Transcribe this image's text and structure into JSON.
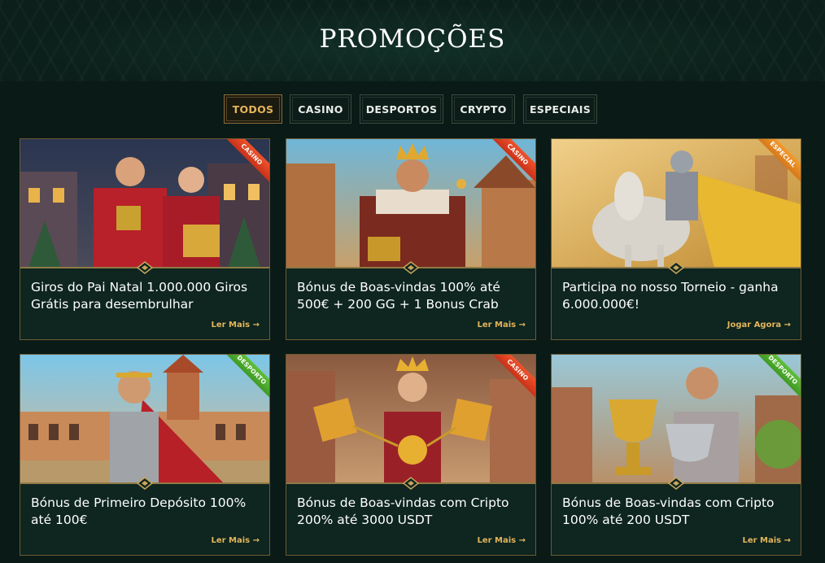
{
  "page": {
    "title": "PROMOÇÕES"
  },
  "filters": [
    {
      "label": "TODOS",
      "active": true
    },
    {
      "label": "CASINO",
      "active": false
    },
    {
      "label": "DESPORTOS",
      "active": false
    },
    {
      "label": "CRYPTO",
      "active": false
    },
    {
      "label": "ESPECIAIS",
      "active": false
    }
  ],
  "promotions": [
    {
      "badge": "CASINO",
      "badge_type": "casino",
      "title": "Giros do Pai Natal 1.000.000 Giros Grátis para desembrulhar",
      "link": "Ler Mais →",
      "image": "santa-couple-christmas"
    },
    {
      "badge": "CASINO",
      "badge_type": "casino",
      "title": "Bónus de Boas-vindas 100% até 500€ + 200 GG + 1 Bonus Crab",
      "link": "Ler Mais →",
      "image": "king-with-treasure"
    },
    {
      "badge": "ESPECIAL",
      "badge_type": "especial",
      "title": "Participa no nosso Torneio - ganha 6.000.000€!",
      "link": "Jogar Agora →",
      "image": "knight-on-horse"
    },
    {
      "badge": "DESPORTO",
      "badge_type": "desporto",
      "title": "Bónus de Primeiro Depósito 100% até 100€",
      "link": "Ler Mais →",
      "image": "gladiator-arena"
    },
    {
      "badge": "CASINO",
      "badge_type": "casino",
      "title": "Bónus de Boas-vindas com Cripto 200% até 3000 USDT",
      "link": "Ler Mais →",
      "image": "queen-crypto-coins"
    },
    {
      "badge": "DESPORTO",
      "badge_type": "desporto",
      "title": "Bónus de Boas-vindas com Cripto 100% até 200 USDT",
      "link": "Ler Mais →",
      "image": "warrior-trophies"
    }
  ],
  "colors": {
    "background": "#0a1a16",
    "card": "#0e2520",
    "gold": "#e3b55a",
    "casino": "#e0401f",
    "especial": "#f08a22",
    "desporto": "#4fae2d"
  }
}
